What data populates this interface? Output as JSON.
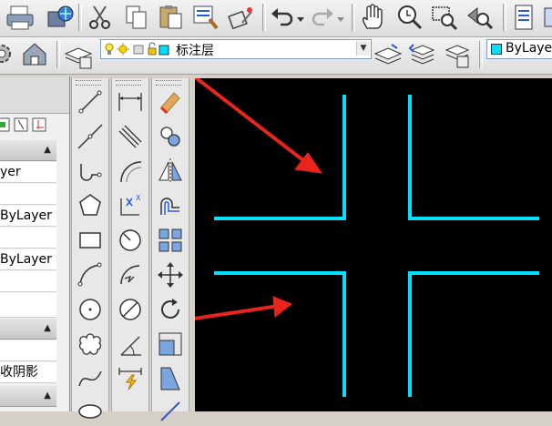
{
  "layer_toolbar": {
    "current_layer": "标注层",
    "color_value": "ByLayer"
  },
  "properties_panel": {
    "rows": [
      "yer",
      "ByLayer",
      "ByLayer",
      "收阴影"
    ]
  },
  "colors": {
    "canvas_bg": "#000000",
    "drawing_line": "#00e0ff",
    "annotation_arrow": "#e8251c"
  }
}
